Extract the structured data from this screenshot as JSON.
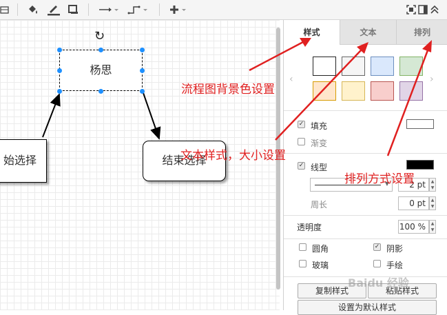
{
  "toolbar": {
    "icons": [
      "table-icon",
      "fill-color-icon",
      "line-color-icon",
      "shadow-icon",
      "connector-straight-icon",
      "waypoints-icon",
      "insert-plus-icon",
      "fit-page-icon",
      "format-panel-icon",
      "collapse-icon"
    ]
  },
  "diagram": {
    "nodes": {
      "center": "杨思",
      "left": "始选择",
      "right": "结束选择"
    }
  },
  "panel": {
    "tabs": [
      "样式",
      "文本",
      "排列"
    ],
    "active_tab": "样式",
    "swatches": [
      "#ffffff",
      "#f5f5f5",
      "#dae8fc",
      "#d5e8d4",
      "#ffe6cc",
      "#fff2cc",
      "#f8cecc",
      "#e1d5e7"
    ],
    "fill_label": "填充",
    "fill_checked": true,
    "gradient_label": "渐变",
    "gradient_checked": false,
    "line_label": "线型",
    "line_checked": true,
    "line_width": "2 pt",
    "perimeter_label": "周长",
    "perimeter_value": "0 pt",
    "opacity_label": "透明度",
    "opacity_value": "100 %",
    "rounded_label": "圆角",
    "rounded_checked": false,
    "shadow_label": "阴影",
    "shadow_checked": true,
    "glass_label": "玻璃",
    "glass_checked": false,
    "sketch_label": "手绘",
    "sketch_checked": false,
    "copy_style": "复制样式",
    "paste_style": "粘贴样式",
    "set_default": "设置为默认样式"
  },
  "annotations": {
    "background": "流程图背景色设置",
    "text": "文本样式，大小设置",
    "arrange": "排列方式设置"
  },
  "watermark": "Baidu 经验"
}
